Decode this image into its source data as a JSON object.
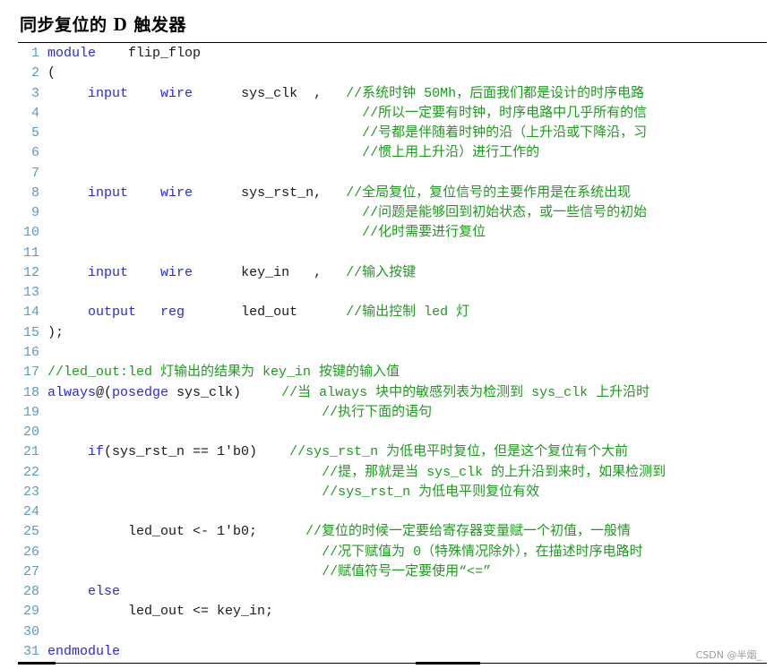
{
  "title": {
    "prefix": "同步复位的 ",
    "letter": "D",
    "suffix": " 触发器"
  },
  "watermark": "CSDN @半烟_",
  "colors": {
    "keyword": "#2a2ad8",
    "comment": "#1e9a1e",
    "line_number": "#5b9bbd",
    "plain": "#1a1a1a"
  },
  "lines": [
    {
      "n": "1",
      "segs": [
        [
          "kw",
          "module"
        ],
        [
          "pl",
          "    flip_flop"
        ]
      ]
    },
    {
      "n": "2",
      "segs": [
        [
          "pl",
          "("
        ]
      ]
    },
    {
      "n": "3",
      "segs": [
        [
          "pl",
          "     "
        ],
        [
          "kw",
          "input"
        ],
        [
          "pl",
          "    "
        ],
        [
          "kw",
          "wire"
        ],
        [
          "pl",
          "      sys_clk  ,   "
        ],
        [
          "cm",
          "//系统时钟 50Mh，后面我们都是设计的时序电路"
        ]
      ]
    },
    {
      "n": "4",
      "segs": [
        [
          "pl",
          "                                       "
        ],
        [
          "cm",
          "//所以一定要有时钟，时序电路中几乎所有的信"
        ]
      ]
    },
    {
      "n": "5",
      "segs": [
        [
          "pl",
          "                                       "
        ],
        [
          "cm",
          "//号都是伴随着时钟的沿（上升沿或下降沿，习"
        ]
      ]
    },
    {
      "n": "6",
      "segs": [
        [
          "pl",
          "                                       "
        ],
        [
          "cm",
          "//惯上用上升沿）进行工作的"
        ]
      ]
    },
    {
      "n": "7",
      "segs": []
    },
    {
      "n": "8",
      "segs": [
        [
          "pl",
          "     "
        ],
        [
          "kw",
          "input"
        ],
        [
          "pl",
          "    "
        ],
        [
          "kw",
          "wire"
        ],
        [
          "pl",
          "      sys_rst_n,   "
        ],
        [
          "cm",
          "//全局复位，复位信号的主要作用是在系统出现"
        ]
      ]
    },
    {
      "n": "9",
      "segs": [
        [
          "pl",
          "                                       "
        ],
        [
          "cm",
          "//问题是能够回到初始状态，或一些信号的初始"
        ]
      ]
    },
    {
      "n": "10",
      "segs": [
        [
          "pl",
          "                                       "
        ],
        [
          "cm",
          "//化时需要进行复位"
        ]
      ]
    },
    {
      "n": "11",
      "segs": []
    },
    {
      "n": "12",
      "segs": [
        [
          "pl",
          "     "
        ],
        [
          "kw",
          "input"
        ],
        [
          "pl",
          "    "
        ],
        [
          "kw",
          "wire"
        ],
        [
          "pl",
          "      key_in   ,   "
        ],
        [
          "cm",
          "//输入按键"
        ]
      ]
    },
    {
      "n": "13",
      "segs": []
    },
    {
      "n": "14",
      "segs": [
        [
          "pl",
          "     "
        ],
        [
          "kw",
          "output"
        ],
        [
          "pl",
          "   "
        ],
        [
          "kw",
          "reg"
        ],
        [
          "pl",
          "       led_out      "
        ],
        [
          "cm",
          "//输出控制 led 灯"
        ]
      ]
    },
    {
      "n": "15",
      "segs": [
        [
          "pl",
          ");"
        ]
      ]
    },
    {
      "n": "16",
      "segs": []
    },
    {
      "n": "17",
      "segs": [
        [
          "cm",
          "//led_out:led 灯输出的结果为 key_in 按键的输入值"
        ]
      ]
    },
    {
      "n": "18",
      "segs": [
        [
          "kw",
          "always"
        ],
        [
          "pl",
          "@("
        ],
        [
          "kw",
          "posedge"
        ],
        [
          "pl",
          " sys_clk)     "
        ],
        [
          "cm",
          "//当 always 块中的敏感列表为检测到 sys_clk 上升沿时"
        ]
      ]
    },
    {
      "n": "19",
      "segs": [
        [
          "pl",
          "                                  "
        ],
        [
          "cm",
          "//执行下面的语句"
        ]
      ]
    },
    {
      "n": "20",
      "segs": []
    },
    {
      "n": "21",
      "segs": [
        [
          "pl",
          "     "
        ],
        [
          "kw",
          "if"
        ],
        [
          "pl",
          "(sys_rst_n == 1'b0)    "
        ],
        [
          "cm",
          "//sys_rst_n 为低电平时复位，但是这个复位有个大前"
        ]
      ]
    },
    {
      "n": "22",
      "segs": [
        [
          "pl",
          "                                  "
        ],
        [
          "cm",
          "//提，那就是当 sys_clk 的上升沿到来时，如果检测到"
        ]
      ]
    },
    {
      "n": "23",
      "segs": [
        [
          "pl",
          "                                  "
        ],
        [
          "cm",
          "//sys_rst_n 为低电平则复位有效"
        ]
      ]
    },
    {
      "n": "24",
      "segs": []
    },
    {
      "n": "25",
      "segs": [
        [
          "pl",
          "          led_out <- 1'b0;      "
        ],
        [
          "cm",
          "//复位的时候一定要给寄存器变量赋一个初值，一般情"
        ]
      ]
    },
    {
      "n": "26",
      "segs": [
        [
          "pl",
          "                                  "
        ],
        [
          "cm",
          "//况下赋值为 0（特殊情况除外），在描述时序电路时"
        ]
      ]
    },
    {
      "n": "27",
      "segs": [
        [
          "pl",
          "                                  "
        ],
        [
          "cm",
          "//赋值符号一定要使用“<=”"
        ]
      ]
    },
    {
      "n": "28",
      "segs": [
        [
          "pl",
          "     "
        ],
        [
          "kw",
          "else"
        ]
      ]
    },
    {
      "n": "29",
      "segs": [
        [
          "pl",
          "          led_out <= key_in;"
        ]
      ]
    },
    {
      "n": "30",
      "segs": []
    },
    {
      "n": "31",
      "segs": [
        [
          "kw",
          "endmodule"
        ]
      ]
    }
  ]
}
